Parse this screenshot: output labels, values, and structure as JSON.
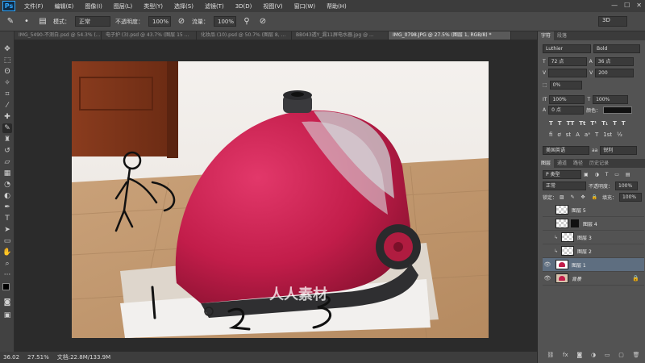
{
  "app": {
    "logo": "Ps"
  },
  "menu": [
    "文件(F)",
    "编辑(E)",
    "图像(I)",
    "图层(L)",
    "类型(Y)",
    "选择(S)",
    "滤镜(T)",
    "3D(D)",
    "视图(V)",
    "窗口(W)",
    "帮助(H)"
  ],
  "options": {
    "mode_label": "模式：",
    "mode_value": "正常",
    "opacity_label": "不透明度：",
    "opacity_value": "100%",
    "flow_label": "流量：",
    "flow_value": "100%",
    "workspace": "3D"
  },
  "tabs": [
    {
      "label": "IMG_5490-不测白.psd @ 54.3% (...",
      "active": false
    },
    {
      "label": "电子护 (3).psd @ 43.7% (图层 15 ...",
      "active": false
    },
    {
      "label": "化妆品 (10).psd @ 50.7% (图层 8, ...",
      "active": false
    },
    {
      "label": "BB043透Y_漏11屏电水器.jpg @ ...",
      "active": false
    },
    {
      "label": "IMG_0798.JPG @ 27.5% (图层 1, RGB/8) *",
      "active": true
    }
  ],
  "status": {
    "zoom": "36.02",
    "zoom2": "27.51%",
    "doc": "文档:22.8M/133.9M"
  },
  "character": {
    "tabs": [
      "字符",
      "段落"
    ],
    "font_family": "Luthier",
    "font_style": "Bold",
    "size": "72 点",
    "leading": "36 点",
    "tracking": "200",
    "scale_pct": "0%",
    "vscale": "100%",
    "hscale": "100%",
    "baseline": "0 点",
    "color_label": "颜色：",
    "language": "美国英语",
    "aa": "锐利"
  },
  "layers_panel": {
    "tabs": [
      "图层",
      "通道",
      "路径",
      "历史记录"
    ],
    "filter": "P 类型",
    "blend": "正常",
    "opacity_label": "不透明度：",
    "opacity": "100%",
    "lock_label": "锁定：",
    "fill_label": "填充：",
    "fill": "100%",
    "layers": [
      {
        "name": "图层 5",
        "visible": false,
        "selected": false
      },
      {
        "name": "图层 4",
        "visible": false,
        "selected": false
      },
      {
        "name": "图层 3",
        "visible": false,
        "selected": false
      },
      {
        "name": "图层 2",
        "visible": false,
        "selected": false
      },
      {
        "name": "图层 1",
        "visible": true,
        "selected": true
      },
      {
        "name": "背景",
        "visible": true,
        "selected": false
      }
    ]
  },
  "watermark": "人人素材",
  "annotations": [
    "1",
    "2",
    "3"
  ]
}
